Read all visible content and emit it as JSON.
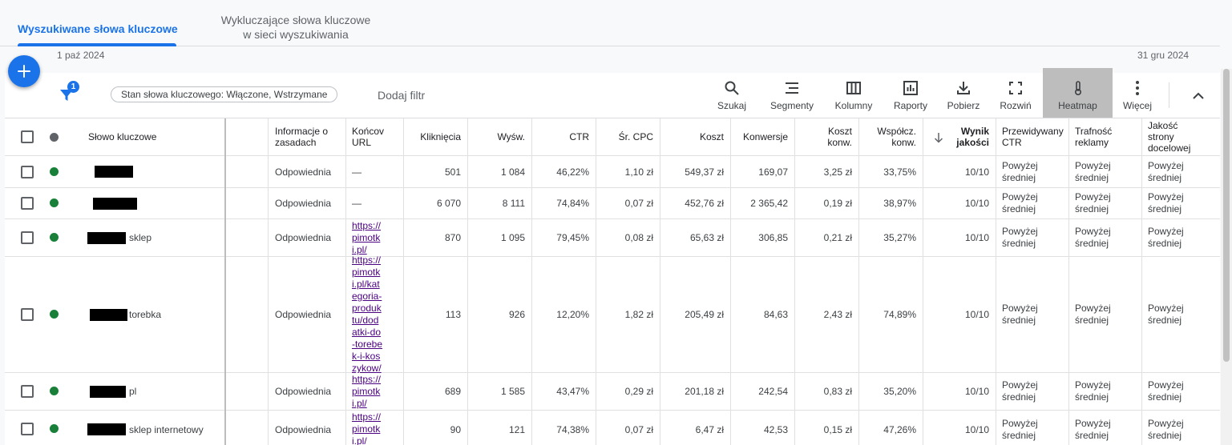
{
  "tabs": {
    "active": "Wyszukiwane słowa kluczowe",
    "second_line1": "Wykluczające słowa kluczowe",
    "second_line2": "w sieci wyszukiwania"
  },
  "dates": {
    "start": "1 paź 2024",
    "end": "31 gru 2024"
  },
  "toolbar": {
    "filter_badge": "1",
    "filter_chip": "Stan słowa kluczowego: Włączone, Wstrzymane",
    "add_filter": "Dodaj filtr",
    "buttons": [
      "Szukaj",
      "Segmenty",
      "Kolumny",
      "Raporty",
      "Pobierz",
      "Rozwiń",
      "Heatmap",
      "Więcej"
    ]
  },
  "columns": {
    "keyword": "Słowo kluczowe",
    "policy_1": "Informacje o",
    "policy_2": "zasadach",
    "url_1": "Końcov",
    "url_2": "URL",
    "clicks": "Kliknięcia",
    "impr": "Wyśw.",
    "ctr": "CTR",
    "cpc": "Śr. CPC",
    "cost": "Koszt",
    "conv": "Konwersje",
    "cost_conv_1": "Koszt",
    "cost_conv_2": "konw.",
    "conv_rate_1": "Współcz.",
    "conv_rate_2": "konw.",
    "qs_1": "Wynik",
    "qs_2": "jakości",
    "exp_ctr_1": "Przewidywany",
    "exp_ctr_2": "CTR",
    "ad_rel_1": "Trafność",
    "ad_rel_2": "reklamy",
    "lp_1": "Jakość",
    "lp_2": "strony",
    "lp_3": "docelowej"
  },
  "rows": [
    {
      "suffix": "",
      "policy": "Odpowiednia",
      "url": "—",
      "clicks": "501",
      "impr": "1 084",
      "ctr": "46,22%",
      "cpc": "1,10 zł",
      "cost": "549,37 zł",
      "conv": "169,07",
      "cost_conv": "3,25 zł",
      "conv_rate": "33,75%",
      "qs": "10/10",
      "q1": "Powyżej",
      "q2": "średniej"
    },
    {
      "suffix": "",
      "policy": "Odpowiednia",
      "url": "—",
      "clicks": "6 070",
      "impr": "8 111",
      "ctr": "74,84%",
      "cpc": "0,07 zł",
      "cost": "452,76 zł",
      "conv": "2 365,42",
      "cost_conv": "0,19 zł",
      "conv_rate": "38,97%",
      "qs": "10/10",
      "q1": "Powyżej",
      "q2": "średniej"
    },
    {
      "suffix": "sklep",
      "policy": "Odpowiednia",
      "url_lines": [
        "https://",
        "pimotk",
        "i.pl/"
      ],
      "clicks": "870",
      "impr": "1 095",
      "ctr": "79,45%",
      "cpc": "0,08 zł",
      "cost": "65,63 zł",
      "conv": "306,85",
      "cost_conv": "0,21 zł",
      "conv_rate": "35,27%",
      "qs": "10/10",
      "q1": "Powyżej",
      "q2": "średniej"
    },
    {
      "suffix": "torebka",
      "policy": "Odpowiednia",
      "url_lines": [
        "https://",
        "pimotk",
        "i.pl/kat",
        "egoria-",
        "produk",
        "tu/dod",
        "atki-do",
        "-torebe",
        "k-i-kos",
        "zykow/"
      ],
      "clicks": "113",
      "impr": "926",
      "ctr": "12,20%",
      "cpc": "1,82 zł",
      "cost": "205,49 zł",
      "conv": "84,63",
      "cost_conv": "2,43 zł",
      "conv_rate": "74,89%",
      "qs": "10/10",
      "q1": "Powyżej",
      "q2": "średniej"
    },
    {
      "suffix": "pl",
      "policy": "Odpowiednia",
      "url_lines": [
        "https://",
        "pimotk",
        "i.pl/"
      ],
      "clicks": "689",
      "impr": "1 585",
      "ctr": "43,47%",
      "cpc": "0,29 zł",
      "cost": "201,18 zł",
      "conv": "242,54",
      "cost_conv": "0,83 zł",
      "conv_rate": "35,20%",
      "qs": "10/10",
      "q1": "Powyżej",
      "q2": "średniej"
    },
    {
      "suffix": "sklep internetowy",
      "policy": "Odpowiednia",
      "url_lines": [
        "https://",
        "pimotk",
        "i.pl/"
      ],
      "clicks": "90",
      "impr": "121",
      "ctr": "74,38%",
      "cpc": "0,07 zł",
      "cost": "6,47 zł",
      "conv": "42,53",
      "cost_conv": "0,15 zł",
      "conv_rate": "47,26%",
      "qs": "10/10",
      "q1": "Powyżej",
      "q2": "średniej"
    }
  ],
  "colors": {
    "accent": "#1a73e8",
    "enabled": "#188038",
    "link": "#4b0082"
  }
}
